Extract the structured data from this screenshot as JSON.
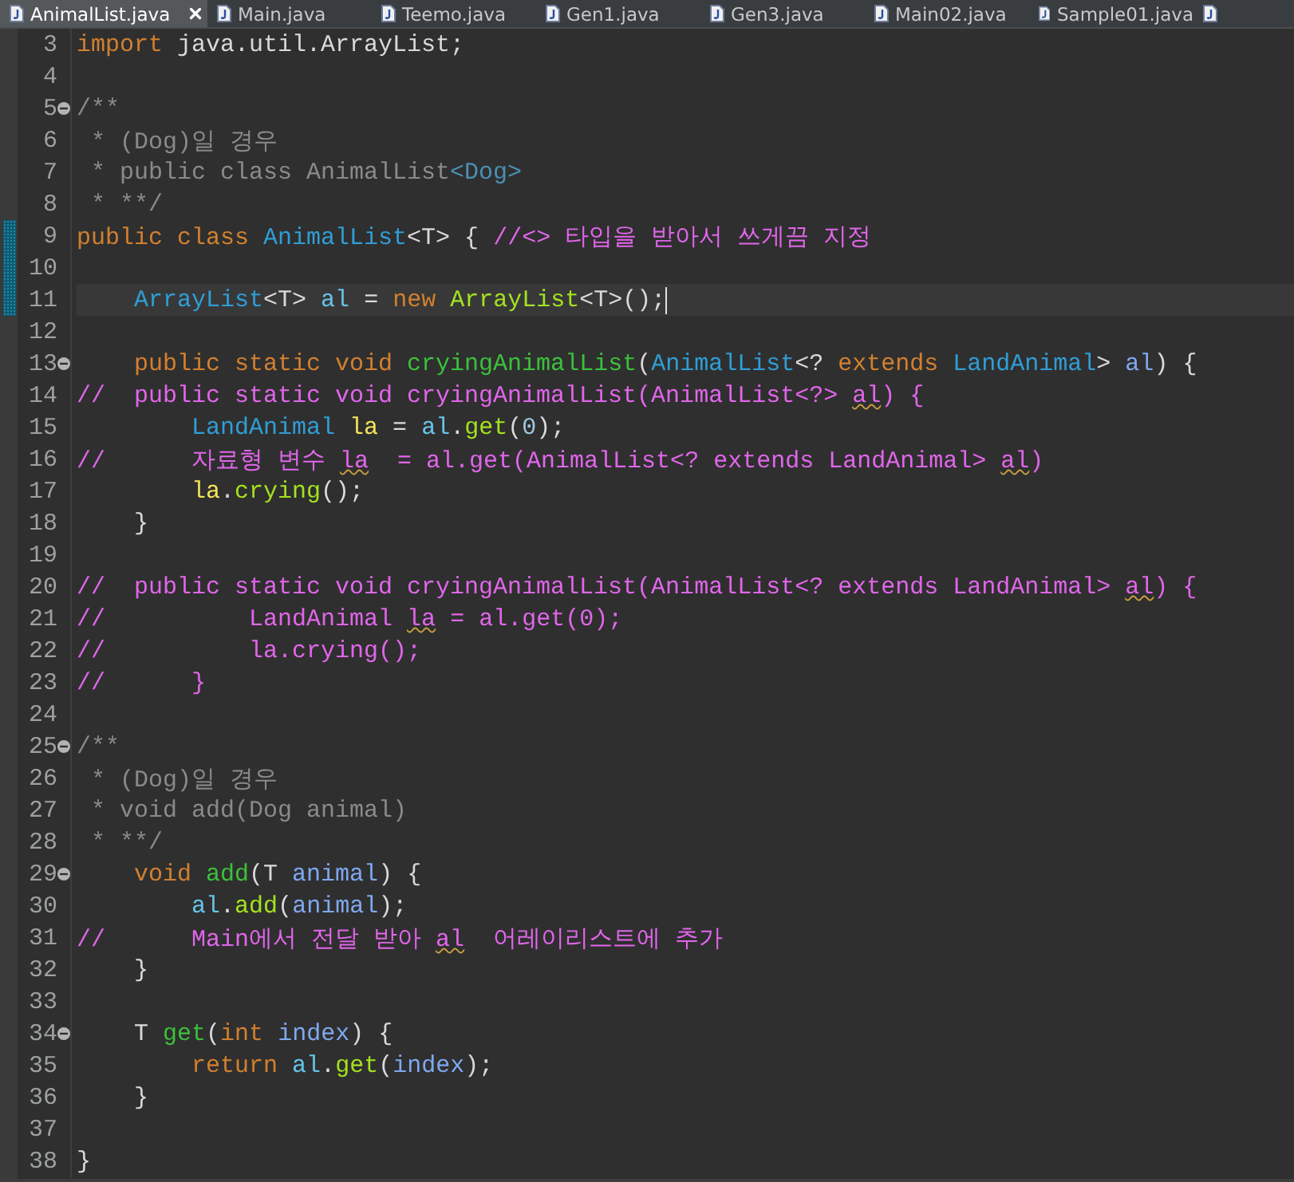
{
  "tabs": [
    {
      "label": "AnimalList.java",
      "selected": true
    },
    {
      "label": "Main.java",
      "selected": false
    },
    {
      "label": "Teemo.java",
      "selected": false
    },
    {
      "label": "Gen1.java",
      "selected": false
    },
    {
      "label": "Gen3.java",
      "selected": false
    },
    {
      "label": "Main02.java",
      "selected": false
    },
    {
      "label": "Sample01.java",
      "selected": false
    }
  ],
  "lines": [
    {
      "n": "3",
      "tokens": [
        {
          "kind": "kw",
          "text": "import"
        },
        {
          "kind": "plain",
          "text": " java.util.ArrayList;"
        }
      ]
    },
    {
      "n": "4"
    },
    {
      "n": "5",
      "fold": true,
      "tokens": [
        {
          "kind": "doc",
          "text": "/**"
        }
      ]
    },
    {
      "n": "6",
      "tokens": [
        {
          "kind": "doc",
          "text": " * (Dog)일 경우"
        }
      ]
    },
    {
      "n": "7",
      "tokens": [
        {
          "kind": "doc",
          "text": " * public class AnimalList"
        },
        {
          "kind": "doctag",
          "text": "<Dog>"
        }
      ]
    },
    {
      "n": "8",
      "tokens": [
        {
          "kind": "doc",
          "text": " * **/"
        }
      ]
    },
    {
      "n": "9",
      "changed": true,
      "tokens": [
        {
          "kind": "kw",
          "text": "public class "
        },
        {
          "kind": "type",
          "text": "AnimalList"
        },
        {
          "kind": "plain",
          "text": "<T> { "
        },
        {
          "kind": "comment",
          "text": "//<> 타입을 받아서 쓰게끔 지정"
        }
      ]
    },
    {
      "n": "10",
      "changed": true
    },
    {
      "n": "11",
      "changed": true,
      "current": true,
      "tokens": [
        {
          "kind": "type",
          "text": "    ArrayList"
        },
        {
          "kind": "plain",
          "text": "<T> "
        },
        {
          "kind": "var",
          "text": "al"
        },
        {
          "kind": "plain",
          "text": " = "
        },
        {
          "kind": "kw",
          "text": "new "
        },
        {
          "kind": "call",
          "text": "ArrayList"
        },
        {
          "kind": "plain",
          "text": "<T>();"
        }
      ]
    },
    {
      "n": "12"
    },
    {
      "n": "13",
      "fold": true,
      "tokens": [
        {
          "kind": "kw",
          "text": "    public static void "
        },
        {
          "kind": "decl",
          "text": "cryingAnimalList"
        },
        {
          "kind": "plain",
          "text": "("
        },
        {
          "kind": "type",
          "text": "AnimalList"
        },
        {
          "kind": "plain",
          "text": "<? "
        },
        {
          "kind": "kw",
          "text": "extends "
        },
        {
          "kind": "type",
          "text": "LandAnimal"
        },
        {
          "kind": "plain",
          "text": "> "
        },
        {
          "kind": "param",
          "text": "al"
        },
        {
          "kind": "plain",
          "text": ") {"
        }
      ]
    },
    {
      "n": "14",
      "tokens": [
        {
          "kind": "comment",
          "text": "//  public static void cryingAnimalList(AnimalList<?> "
        },
        {
          "kind": "warn",
          "text": "al"
        },
        {
          "kind": "comment",
          "text": ") {"
        }
      ]
    },
    {
      "n": "15",
      "tokens": [
        {
          "kind": "type",
          "text": "        LandAnimal "
        },
        {
          "kind": "local",
          "text": "la"
        },
        {
          "kind": "plain",
          "text": " = "
        },
        {
          "kind": "var",
          "text": "al"
        },
        {
          "kind": "plain",
          "text": "."
        },
        {
          "kind": "call",
          "text": "get"
        },
        {
          "kind": "plain",
          "text": "("
        },
        {
          "kind": "number",
          "text": "0"
        },
        {
          "kind": "plain",
          "text": ");"
        }
      ]
    },
    {
      "n": "16",
      "tokens": [
        {
          "kind": "comment",
          "text": "//      자료형 변수 "
        },
        {
          "kind": "warn",
          "text": "la"
        },
        {
          "kind": "comment",
          "text": "  = al.get(AnimalList<? extends LandAnimal> "
        },
        {
          "kind": "warn",
          "text": "al"
        },
        {
          "kind": "comment",
          "text": ")"
        }
      ]
    },
    {
      "n": "17",
      "tokens": [
        {
          "kind": "local",
          "text": "        la"
        },
        {
          "kind": "plain",
          "text": "."
        },
        {
          "kind": "call",
          "text": "crying"
        },
        {
          "kind": "plain",
          "text": "();"
        }
      ]
    },
    {
      "n": "18",
      "tokens": [
        {
          "kind": "plain",
          "text": "    }"
        }
      ]
    },
    {
      "n": "19"
    },
    {
      "n": "20",
      "tokens": [
        {
          "kind": "comment",
          "text": "//  public static void cryingAnimalList(AnimalList<? extends LandAnimal> "
        },
        {
          "kind": "warn",
          "text": "al"
        },
        {
          "kind": "comment",
          "text": ") {"
        }
      ]
    },
    {
      "n": "21",
      "tokens": [
        {
          "kind": "comment",
          "text": "//          LandAnimal "
        },
        {
          "kind": "warn",
          "text": "la"
        },
        {
          "kind": "comment",
          "text": " = al.get(0);"
        }
      ]
    },
    {
      "n": "22",
      "tokens": [
        {
          "kind": "comment",
          "text": "//          la.crying();"
        }
      ]
    },
    {
      "n": "23",
      "tokens": [
        {
          "kind": "comment",
          "text": "//      }"
        }
      ]
    },
    {
      "n": "24"
    },
    {
      "n": "25",
      "fold": true,
      "tokens": [
        {
          "kind": "doc",
          "text": "/**"
        }
      ]
    },
    {
      "n": "26",
      "tokens": [
        {
          "kind": "doc",
          "text": " * (Dog)일 경우"
        }
      ]
    },
    {
      "n": "27",
      "tokens": [
        {
          "kind": "doc",
          "text": " * void add(Dog animal)"
        }
      ]
    },
    {
      "n": "28",
      "tokens": [
        {
          "kind": "doc",
          "text": " * **/"
        }
      ]
    },
    {
      "n": "29",
      "fold": true,
      "tokens": [
        {
          "kind": "kw",
          "text": "    void "
        },
        {
          "kind": "decl",
          "text": "add"
        },
        {
          "kind": "plain",
          "text": "(T "
        },
        {
          "kind": "param",
          "text": "animal"
        },
        {
          "kind": "plain",
          "text": ") {"
        }
      ]
    },
    {
      "n": "30",
      "tokens": [
        {
          "kind": "var",
          "text": "        al"
        },
        {
          "kind": "plain",
          "text": "."
        },
        {
          "kind": "call",
          "text": "add"
        },
        {
          "kind": "plain",
          "text": "("
        },
        {
          "kind": "param",
          "text": "animal"
        },
        {
          "kind": "plain",
          "text": ");"
        }
      ]
    },
    {
      "n": "31",
      "tokens": [
        {
          "kind": "comment",
          "text": "//      Main에서 전달 받아 "
        },
        {
          "kind": "warn",
          "text": "al"
        },
        {
          "kind": "comment",
          "text": "  어레이리스트에 추가"
        }
      ]
    },
    {
      "n": "32",
      "tokens": [
        {
          "kind": "plain",
          "text": "    }"
        }
      ]
    },
    {
      "n": "33"
    },
    {
      "n": "34",
      "fold": true,
      "tokens": [
        {
          "kind": "plain",
          "text": "    T "
        },
        {
          "kind": "decl",
          "text": "get"
        },
        {
          "kind": "plain",
          "text": "("
        },
        {
          "kind": "kw",
          "text": "int "
        },
        {
          "kind": "param",
          "text": "index"
        },
        {
          "kind": "plain",
          "text": ") {"
        }
      ]
    },
    {
      "n": "35",
      "tokens": [
        {
          "kind": "kw",
          "text": "        return "
        },
        {
          "kind": "var",
          "text": "al"
        },
        {
          "kind": "plain",
          "text": "."
        },
        {
          "kind": "call",
          "text": "get"
        },
        {
          "kind": "plain",
          "text": "("
        },
        {
          "kind": "param",
          "text": "index"
        },
        {
          "kind": "plain",
          "text": ");"
        }
      ]
    },
    {
      "n": "36",
      "tokens": [
        {
          "kind": "plain",
          "text": "    }"
        }
      ]
    },
    {
      "n": "37"
    },
    {
      "n": "38",
      "tokens": [
        {
          "kind": "plain",
          "text": "}"
        }
      ]
    }
  ]
}
